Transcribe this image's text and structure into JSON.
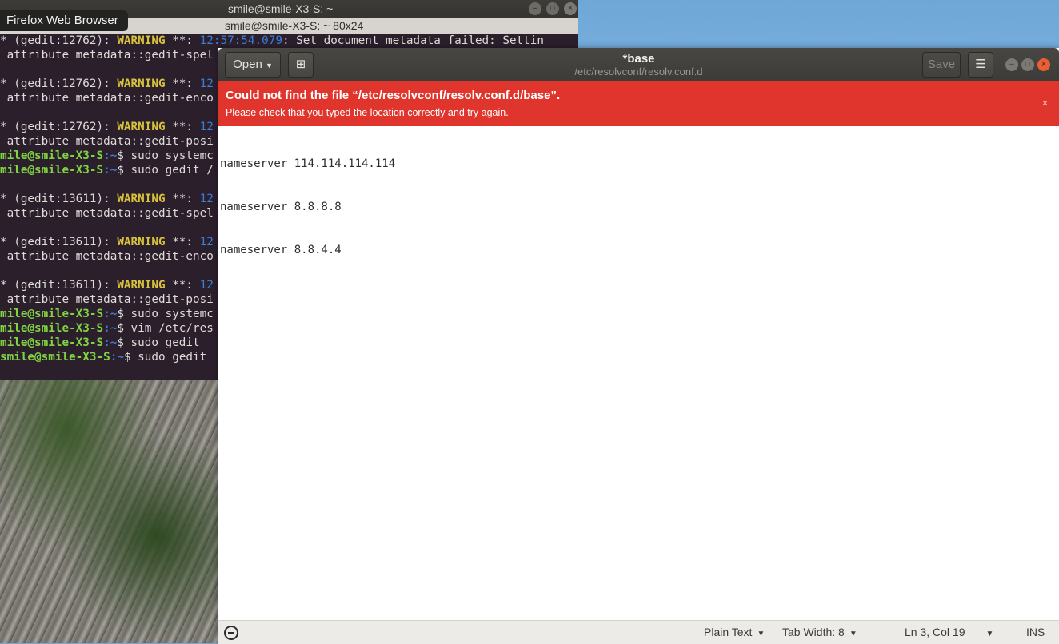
{
  "desktop": {
    "firefox_tooltip": "Firefox Web Browser"
  },
  "terminal": {
    "title": "smile@smile-X3-S: ~",
    "tab_label": "smile@smile-X3-S: ~ 80x24",
    "lines": [
      {
        "pre": "* (gedit:12762): ",
        "warn": "WARNING",
        "mid": " **: ",
        "time": "12:57:54.079",
        "rest": ": Set document metadata failed: Settin"
      },
      {
        "text": " attribute metadata::gedit-spel"
      },
      {
        "text": ""
      },
      {
        "pre": "* (gedit:12762): ",
        "warn": "WARNING",
        "mid": " **: ",
        "time": "12",
        "rest": ""
      },
      {
        "text": " attribute metadata::gedit-enco"
      },
      {
        "text": ""
      },
      {
        "pre": "* (gedit:12762): ",
        "warn": "WARNING",
        "mid": " **: ",
        "time": "12",
        "rest": ""
      },
      {
        "text": " attribute metadata::gedit-posi"
      },
      {
        "user": "mile@smile-X3-S",
        "path": ":~",
        "cmd": "$ sudo systemc"
      },
      {
        "user": "mile@smile-X3-S",
        "path": ":~",
        "cmd": "$ sudo gedit /"
      },
      {
        "text": ""
      },
      {
        "pre": "* (gedit:13611): ",
        "warn": "WARNING",
        "mid": " **: ",
        "time": "12",
        "rest": ""
      },
      {
        "text": " attribute metadata::gedit-spel"
      },
      {
        "text": ""
      },
      {
        "pre": "* (gedit:13611): ",
        "warn": "WARNING",
        "mid": " **: ",
        "time": "12",
        "rest": ""
      },
      {
        "text": " attribute metadata::gedit-enco"
      },
      {
        "text": ""
      },
      {
        "pre": "* (gedit:13611): ",
        "warn": "WARNING",
        "mid": " **: ",
        "time": "12",
        "rest": ""
      },
      {
        "text": " attribute metadata::gedit-posi"
      },
      {
        "user": "mile@smile-X3-S",
        "path": ":~",
        "cmd": "$ sudo systemc"
      },
      {
        "user": "mile@smile-X3-S",
        "path": ":~",
        "cmd": "$ vim /etc/res"
      },
      {
        "user": "mile@smile-X3-S",
        "path": ":~",
        "cmd": "$ sudo gedit"
      },
      {
        "user": "smile@smile-X3-S",
        "path": ":~",
        "cmd": "$ sudo gedit"
      }
    ]
  },
  "gedit": {
    "open_label": "Open",
    "save_label": "Save",
    "doc_title": "*base",
    "doc_path": "/etc/resolvconf/resolv.conf.d",
    "infobar": {
      "title": "Could not find the file “/etc/resolvconf/resolv.conf.d/base”.",
      "message": "Please check that you typed the location correctly and try again.",
      "close": "×"
    },
    "editor_lines": [
      "nameserver 114.114.114.114",
      "nameserver 8.8.8.8",
      "nameserver 8.8.4.4"
    ],
    "statusbar": {
      "language": "Plain Text",
      "tab_width": "Tab Width: 8",
      "position": "Ln 3, Col 19",
      "mode": "INS"
    }
  },
  "colors": {
    "infobar_bg": "#e0352c",
    "warning": "#d7c23a",
    "prompt_user": "#80d341",
    "prompt_path": "#3b7dd8"
  }
}
